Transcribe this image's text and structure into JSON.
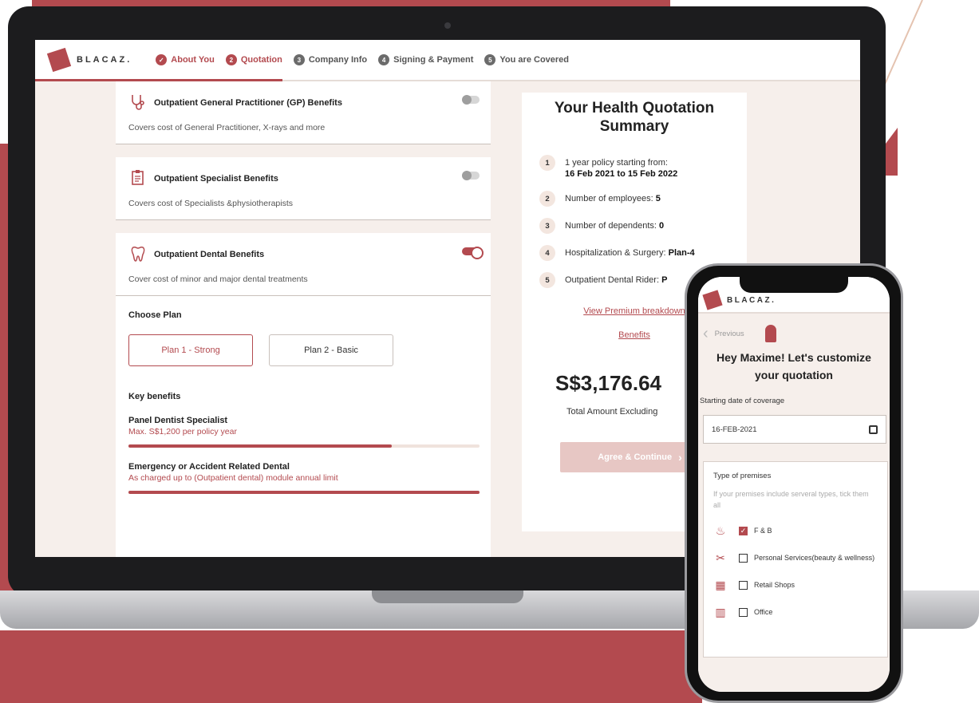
{
  "colors": {
    "accent": "#b34a4f",
    "accent_light": "#e7c7c4",
    "page_bg": "#f6efeb"
  },
  "brand": {
    "name": "BLACAZ."
  },
  "steps": [
    {
      "num": "✓",
      "label": "About You"
    },
    {
      "num": "2",
      "label": "Quotation"
    },
    {
      "num": "3",
      "label": "Company Info"
    },
    {
      "num": "4",
      "label": "Signing & Payment"
    },
    {
      "num": "5",
      "label": "You are Covered"
    }
  ],
  "benefits": [
    {
      "icon": "stethoscope-icon",
      "title": "Outpatient General Practitioner (GP) Benefits",
      "desc": "Covers cost of General Practitioner, X-rays and more",
      "enabled": false
    },
    {
      "icon": "clipboard-icon",
      "title": "Outpatient Specialist Benefits",
      "desc": "Covers cost of Specialists &physiotherapists",
      "enabled": false
    },
    {
      "icon": "tooth-icon",
      "title": "Outpatient Dental Benefits",
      "desc": "Cover cost of minor and major dental treatments",
      "enabled": true
    }
  ],
  "plan_choice": {
    "title": "Choose Plan",
    "plans": [
      "Plan 1 - Strong",
      "Plan 2 - Basic"
    ],
    "key_benefits_title": "Key benefits",
    "key_benefits": [
      {
        "name": "Panel Dentist Specialist",
        "sub": "Max. S$1,200 per policy year",
        "fill": 0.75
      },
      {
        "name": "Emergency or Accident Related Dental",
        "sub": "As charged up to (Outpatient dental) module annual limit",
        "fill": 1.0
      }
    ]
  },
  "summary": {
    "title_line1": "Your Health Quotation",
    "title_line2": "Summary",
    "items": [
      {
        "num": "1",
        "label": "1 year policy starting from:",
        "value": "16 Feb 2021 to 15 Feb 2022"
      },
      {
        "num": "2",
        "label": "Number of employees:",
        "value": "5"
      },
      {
        "num": "3",
        "label": "Number of dependents:",
        "value": "0"
      },
      {
        "num": "4",
        "label": "Hospitalization & Surgery:",
        "value": "Plan-4"
      },
      {
        "num": "5",
        "label": "Outpatient Dental Rider:",
        "value": "P"
      }
    ],
    "link_line1": "View Premium breakdown",
    "link_line2": "Benefits",
    "price": "S$3,176.64",
    "price_note": "Total Amount Excluding",
    "cta": "Agree & Continue"
  },
  "phone": {
    "brand": "BLACAZ.",
    "prev_label": "Previous",
    "greeting_line1": "Hey Maxime! Let's customize",
    "greeting_line2": "your quotation",
    "start_label": "Starting date of coverage",
    "start_value": "16-FEB-2021",
    "premises_title": "Type of premises",
    "premises_help": "If your premises include serveral types, tick them all",
    "premises": [
      {
        "icon": "food-icon",
        "label": "F & B",
        "checked": true
      },
      {
        "icon": "scissors-icon",
        "label": "Personal Services(beauty & wellness)",
        "checked": false
      },
      {
        "icon": "shop-icon",
        "label": "Retail Shops",
        "checked": false
      },
      {
        "icon": "building-icon",
        "label": "Office",
        "checked": false
      }
    ]
  }
}
